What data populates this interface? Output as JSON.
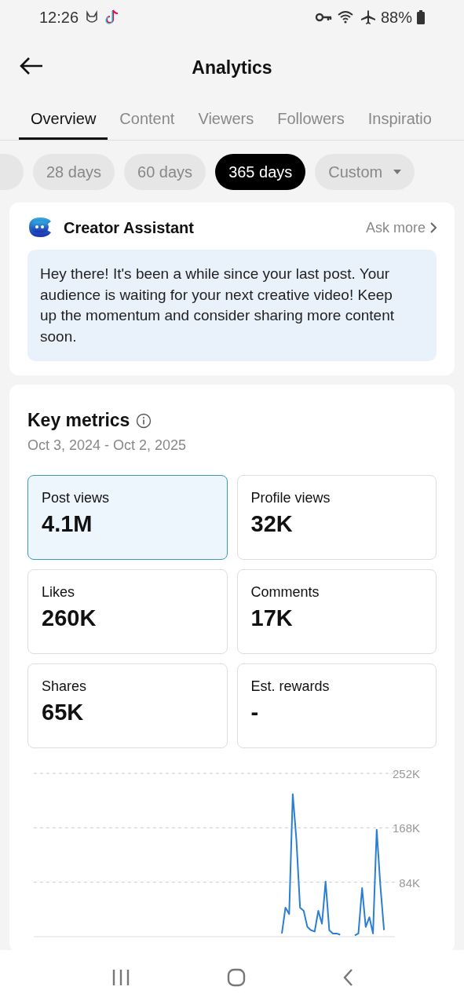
{
  "status_bar": {
    "time": "12:26",
    "battery": "88%"
  },
  "header": {
    "title": "Analytics"
  },
  "tabs": [
    {
      "label": "Overview",
      "selected": true
    },
    {
      "label": "Content",
      "selected": false
    },
    {
      "label": "Viewers",
      "selected": false
    },
    {
      "label": "Followers",
      "selected": false
    },
    {
      "label": "Inspiratio",
      "selected": false
    }
  ],
  "ranges": [
    {
      "label": "28 days",
      "selected": false,
      "kind": "chip"
    },
    {
      "label": "60 days",
      "selected": false,
      "kind": "chip"
    },
    {
      "label": "365 days",
      "selected": true,
      "kind": "chip"
    },
    {
      "label": "Custom",
      "selected": false,
      "kind": "dropdown"
    }
  ],
  "assistant": {
    "title": "Creator Assistant",
    "link": "Ask more",
    "message": "Hey there! It's been a while since your last post. Your audience is waiting for your next creative video! Keep up the momentum and consider sharing more content soon."
  },
  "key_metrics": {
    "title": "Key metrics",
    "date_range": "Oct 3, 2024 - Oct 2, 2025",
    "metrics": [
      {
        "label": "Post views",
        "value": "4.1M",
        "selected": true
      },
      {
        "label": "Profile views",
        "value": "32K",
        "selected": false
      },
      {
        "label": "Likes",
        "value": "260K",
        "selected": false
      },
      {
        "label": "Comments",
        "value": "17K",
        "selected": false
      },
      {
        "label": "Shares",
        "value": "65K",
        "selected": false
      },
      {
        "label": "Est. rewards",
        "value": "-",
        "selected": false
      }
    ],
    "chart_data": {
      "type": "line",
      "ylim": [
        0,
        252000
      ],
      "yticks": [
        {
          "value": 84000,
          "label": "84K"
        },
        {
          "value": 168000,
          "label": "168K"
        },
        {
          "value": 252000,
          "label": "252K"
        }
      ],
      "series": [
        {
          "color": "#2a7fd4",
          "values": [
            null,
            null,
            null,
            null,
            null,
            null,
            null,
            null,
            null,
            null,
            null,
            null,
            null,
            null,
            null,
            null,
            null,
            null,
            null,
            null,
            null,
            null,
            null,
            null,
            null,
            null,
            null,
            null,
            null,
            null,
            null,
            null,
            null,
            null,
            null,
            null,
            null,
            null,
            null,
            null,
            null,
            null,
            null,
            null,
            null,
            null,
            null,
            null,
            null,
            null,
            null,
            null,
            null,
            null,
            null,
            null,
            null,
            null,
            null,
            null,
            null,
            null,
            null,
            null,
            null,
            null,
            null,
            null,
            5000,
            45000,
            35000,
            220000,
            150000,
            45000,
            40000,
            15000,
            10000,
            8000,
            40000,
            20000,
            85000,
            10000,
            5000,
            5000,
            3000,
            null,
            null,
            null,
            2000,
            5000,
            75000,
            15000,
            30000,
            5000,
            165000,
            80000,
            10000,
            null,
            null,
            null
          ]
        }
      ]
    }
  }
}
